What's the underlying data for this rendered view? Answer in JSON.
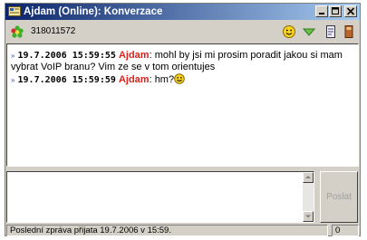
{
  "window": {
    "title": "Ajdam (Online): Konverzace",
    "controls": [
      "minimize",
      "maximize",
      "close"
    ]
  },
  "contact": {
    "uin": "318011572",
    "status_icon": "icq-flower-icon"
  },
  "toolbar": {
    "icons": [
      "smiley-icon",
      "dropdown-triangle-icon",
      "contact-info-icon",
      "history-book-icon"
    ]
  },
  "messages": [
    {
      "timestamp": "19.7.2006 15:59:55",
      "nick": "Ajdam",
      "text": ": mohl by jsi mi prosim poradit jakou si mam vybrat VoIP branu? Vim ze se v tom orientujes"
    },
    {
      "timestamp": "19.7.2006 15:59:59",
      "nick": "Ajdam",
      "text": ": hm?"
    }
  ],
  "compose": {
    "value": "",
    "send_label": "Poslat"
  },
  "statusbar": {
    "text": "Poslední zpráva přijata 19.7.2006 v 15:59.",
    "count": "0"
  },
  "colors": {
    "titlebar_start": "#0a246a",
    "titlebar_end": "#a6caf0",
    "nick": "#e0201a",
    "face": "#d4d0c8"
  }
}
